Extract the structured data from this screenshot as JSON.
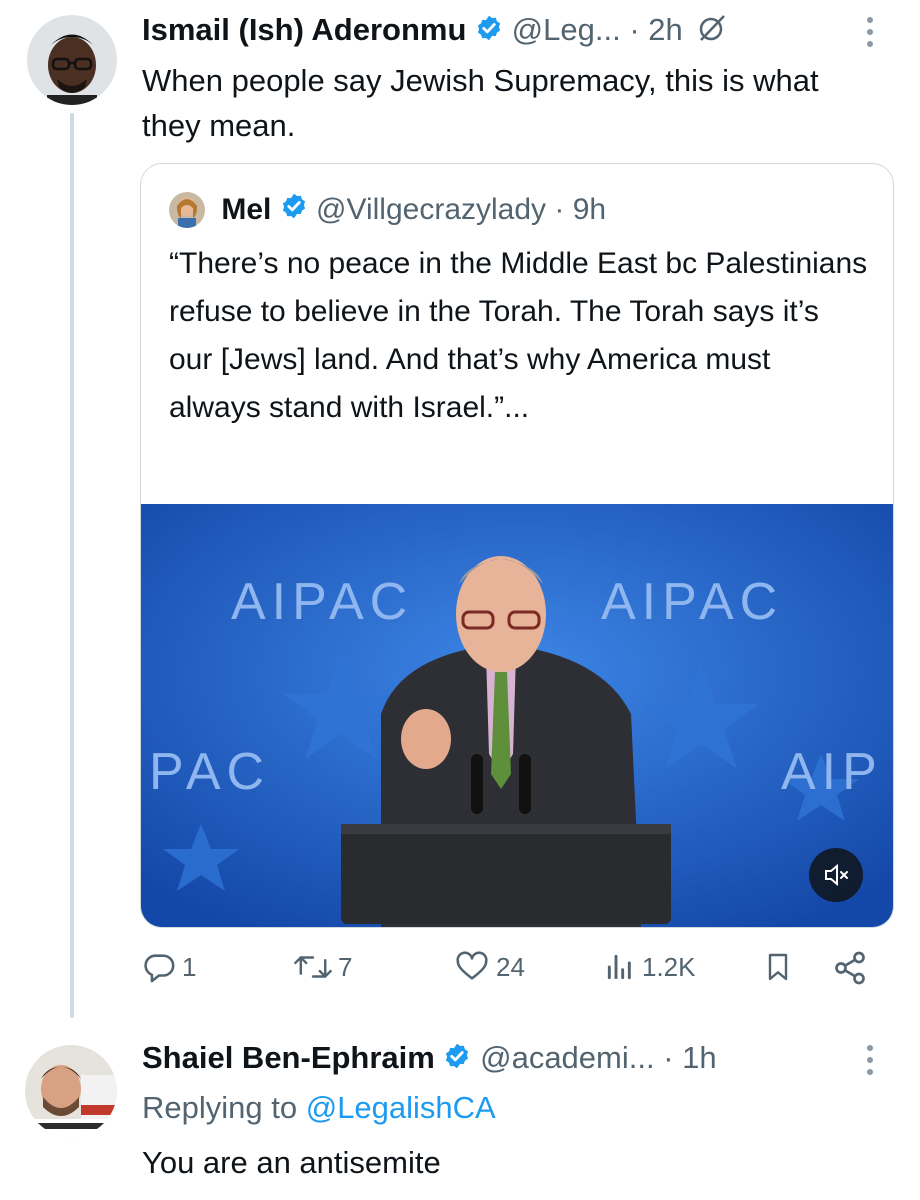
{
  "tweet1": {
    "author_name": "Ismail (Ish) Aderonmu",
    "handle": "@Leg...",
    "time": "· 2h",
    "text": "When people say Jewish Supremacy, this is what they mean."
  },
  "quote": {
    "author_name": "Mel",
    "handle": "@Villgecrazylady",
    "time": "· 9h",
    "text": "“There’s no peace in the Middle East bc Palestinians refuse to believe in the Torah. The Torah says it’s our [Jews] land. And that’s why America must always stand with Israel.”...",
    "media_banner_texts": [
      "AIPAC",
      "AIPAC",
      "PAC",
      "AIP"
    ]
  },
  "actions": {
    "replies": "1",
    "reposts": "7",
    "likes": "24",
    "views": "1.2K"
  },
  "tweet2": {
    "author_name": "Shaiel Ben-Ephraim",
    "handle": "@academi...",
    "time": "· 1h",
    "replying_prefix": "Replying to",
    "replying_to": "@LegalishCA",
    "text": "You are an antisemite"
  },
  "colors": {
    "verified": "#1d9bf0",
    "link": "#1d9bf0",
    "muted": "#536471",
    "media_bg": "#1e5fc4"
  }
}
